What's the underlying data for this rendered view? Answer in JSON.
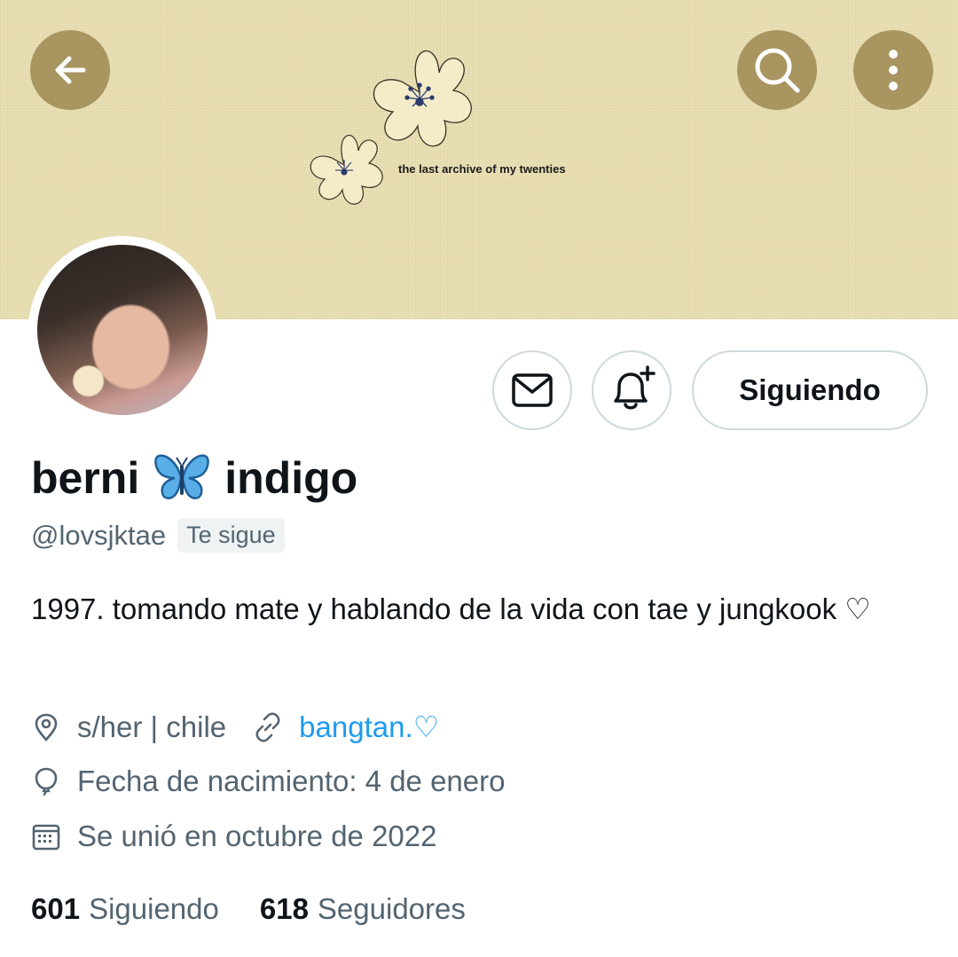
{
  "header": {
    "banner_caption": "the last archive of my twenties",
    "back_icon": "arrow-left-icon",
    "search_icon": "search-icon",
    "more_icon": "more-vertical-icon"
  },
  "actions": {
    "message_icon": "mail-icon",
    "notify_icon": "bell-plus-icon",
    "follow_label": "Siguiendo"
  },
  "profile": {
    "name_first": "berni",
    "name_emoji": "butterfly-icon",
    "name_last": "indigo",
    "handle": "@lovsjktae",
    "follows_you": "Te sigue",
    "bio": "1997. tomando mate y hablando de la vida con tae y jungkook ♡",
    "location": "s/her | chile",
    "link": "bangtan.♡",
    "birthday": "Fecha de nacimiento: 4 de enero",
    "joined": "Se unió en octubre de 2022"
  },
  "stats": {
    "following_count": "601",
    "following_label": "Siguiendo",
    "followers_count": "618",
    "followers_label": "Seguidores"
  },
  "colors": {
    "banner": "#e9dfb4",
    "banner_button": "#a8955f",
    "link": "#1d9bf0",
    "secondary_text": "#536471"
  }
}
